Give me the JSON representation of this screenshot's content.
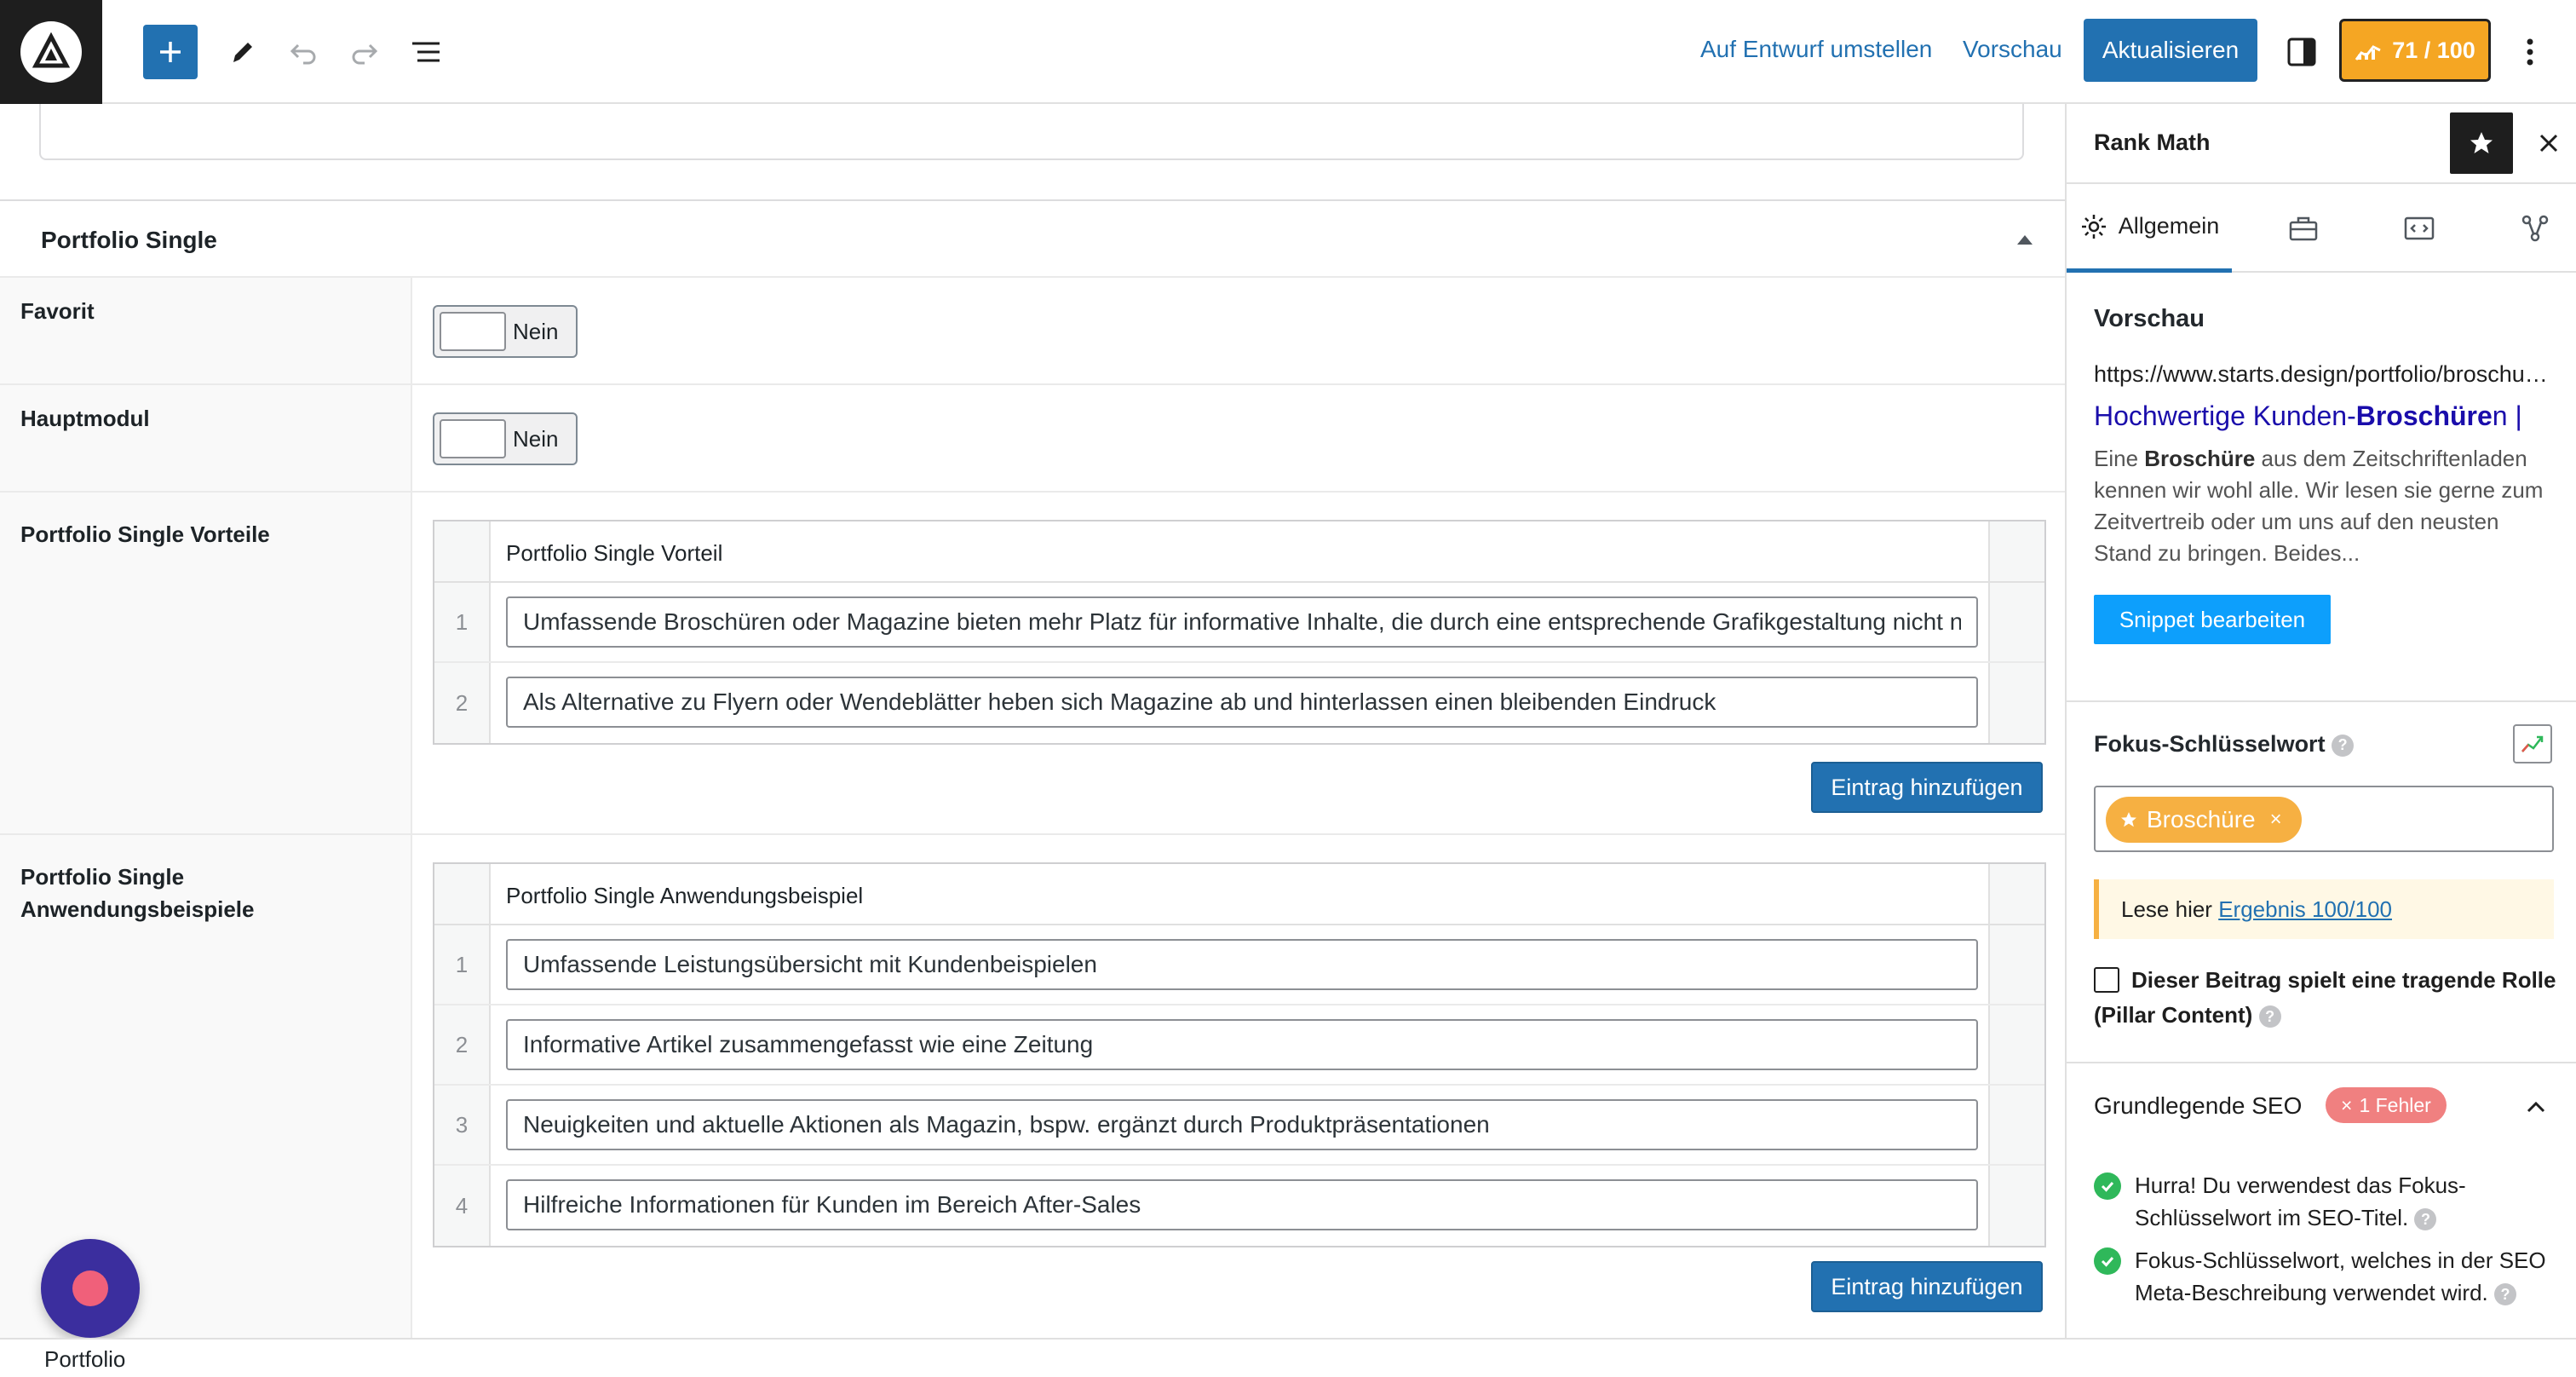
{
  "toolbar": {
    "draft_link": "Auf Entwurf umstellen",
    "preview_link": "Vorschau",
    "update_button": "Aktualisieren",
    "seo_score": "71 / 100"
  },
  "main": {
    "section_title": "Portfolio Single",
    "favorit": {
      "label": "Favorit",
      "value": "Nein"
    },
    "hauptmodul": {
      "label": "Hauptmodul",
      "value": "Nein"
    },
    "vorteile": {
      "label": "Portfolio Single Vorteile",
      "column_header": "Portfolio Single Vorteil",
      "rows": [
        {
          "num": "1",
          "value": "Umfassende Broschüren oder Magazine bieten mehr Platz für informative Inhalte, die durch eine entsprechende Grafikgestaltung nicht nur informativ, sondern auch ansprechend sind"
        },
        {
          "num": "2",
          "value": "Als Alternative zu Flyern oder Wendeblätter heben sich Magazine ab und hinterlassen einen bleibenden Eindruck"
        }
      ],
      "add_button": "Eintrag hinzufügen"
    },
    "anwendungsbeispiele": {
      "label": "Portfolio Single Anwendungsbeispiele",
      "column_header": "Portfolio Single Anwendungsbeispiel",
      "rows": [
        {
          "num": "1",
          "value": "Umfassende Leistungsübersicht mit Kundenbeispielen"
        },
        {
          "num": "2",
          "value": "Informative Artikel zusammengefasst wie eine Zeitung"
        },
        {
          "num": "3",
          "value": "Neuigkeiten und aktuelle Aktionen als Magazin, bspw. ergänzt durch Produktpräsentationen"
        },
        {
          "num": "4",
          "value": "Hilfreiche Informationen für Kunden im Bereich After-Sales"
        }
      ],
      "add_button": "Eintrag hinzufügen"
    }
  },
  "footer": {
    "breadcrumb": "Portfolio"
  },
  "sidebar": {
    "title": "Rank Math",
    "tabs": [
      {
        "label": "Allgemein"
      }
    ],
    "preview": {
      "heading": "Vorschau",
      "url": "https://www.starts.design/portfolio/broschueren/",
      "serp_title_pre": "Hochwertige Kunden-",
      "serp_title_bold": "Broschüre",
      "serp_title_post": "n | ",
      "desc_pre": "Eine ",
      "desc_bold": "Broschüre",
      "desc_post": " aus dem Zeitschriftenladen kennen wir wohl alle. Wir lesen sie gerne zum Zeitvertreib oder um uns auf den neusten Stand zu bringen. Beides...",
      "edit_button": "Snippet bearbeiten"
    },
    "focus": {
      "label": "Fokus-Schlüsselwort",
      "keyword": "Broschüre",
      "notice_pre": "Lese hier ",
      "notice_link": "Ergebnis 100/100",
      "pillar_text": "Dieser Beitrag spielt eine tragende Rolle (Pillar Content)"
    },
    "basic_seo": {
      "title": "Grundlegende SEO",
      "error_badge": "1 Fehler",
      "checks": [
        "Hurra! Du verwendest das Fokus-Schlüsselwort im SEO-Titel.",
        "Fokus-Schlüsselwort, welches in der SEO Meta-Beschreibung verwendet wird."
      ]
    }
  },
  "colors": {
    "accent": "#2271b1",
    "score": "#f5a623",
    "serp_title": "#1a0dab",
    "success": "#2fb85a",
    "error": "#f08080",
    "fab": "#3b2e9e"
  },
  "icons": [
    "site-logo-icon",
    "plus-icon",
    "pencil-icon",
    "undo-icon",
    "redo-icon",
    "list-view-icon",
    "sidebar-toggle-icon",
    "rank-math-chart-icon",
    "more-vertical-icon",
    "star-icon",
    "close-icon",
    "gear-icon",
    "toolbox-icon",
    "snippet-icon",
    "schema-icon",
    "trend-icon",
    "help-icon",
    "check-icon",
    "chevron-up-icon"
  ]
}
